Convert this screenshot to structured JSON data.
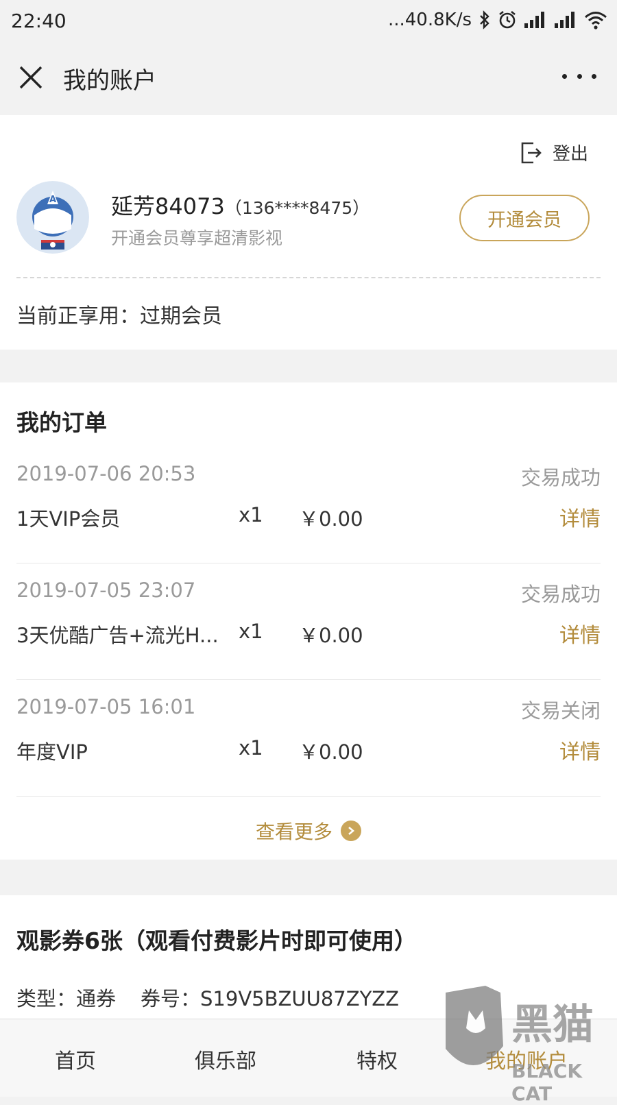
{
  "status_bar": {
    "time": "22:40",
    "network_speed": "...40.8K/s",
    "icons": [
      "bluetooth-icon",
      "alarm-icon",
      "signal-icon",
      "signal-icon",
      "wifi-icon"
    ]
  },
  "header": {
    "title": "我的账户",
    "close_icon": "close-icon",
    "more_icon": "more-icon"
  },
  "account": {
    "logout_label": "登出",
    "user_name": "延芳84073",
    "phone": "（136****8475）",
    "subtitle": "开通会员尊享超清影视",
    "vip_button": "开通会员",
    "current_status": "当前正享用：过期会员"
  },
  "orders": {
    "title": "我的订单",
    "items": [
      {
        "date": "2019-07-06 20:53",
        "status": "交易成功",
        "product": "1天VIP会员",
        "qty": "x1",
        "price": "￥0.00",
        "detail": "详情"
      },
      {
        "date": "2019-07-05 23:07",
        "status": "交易成功",
        "product": "3天优酷广告+流光H...",
        "qty": "x1",
        "price": "￥0.00",
        "detail": "详情"
      },
      {
        "date": "2019-07-05 16:01",
        "status": "交易关闭",
        "product": "年度VIP",
        "qty": "x1",
        "price": "￥0.00",
        "detail": "详情"
      }
    ],
    "more_label": "查看更多"
  },
  "tickets": {
    "title": "观影券6张（观看付费影片时即可使用）",
    "type_label": "类型：通券",
    "code_label": "券号：S19V5BZUU87ZYZZ"
  },
  "bottom_nav": {
    "items": [
      "首页",
      "俱乐部",
      "特权",
      "我的账户"
    ]
  },
  "watermark": {
    "text_cn": "黑猫",
    "text_en": "BLACK CAT"
  },
  "colors": {
    "accent": "#b38c3c",
    "accent_border": "#c9a55a",
    "progress": "#27c93f"
  }
}
